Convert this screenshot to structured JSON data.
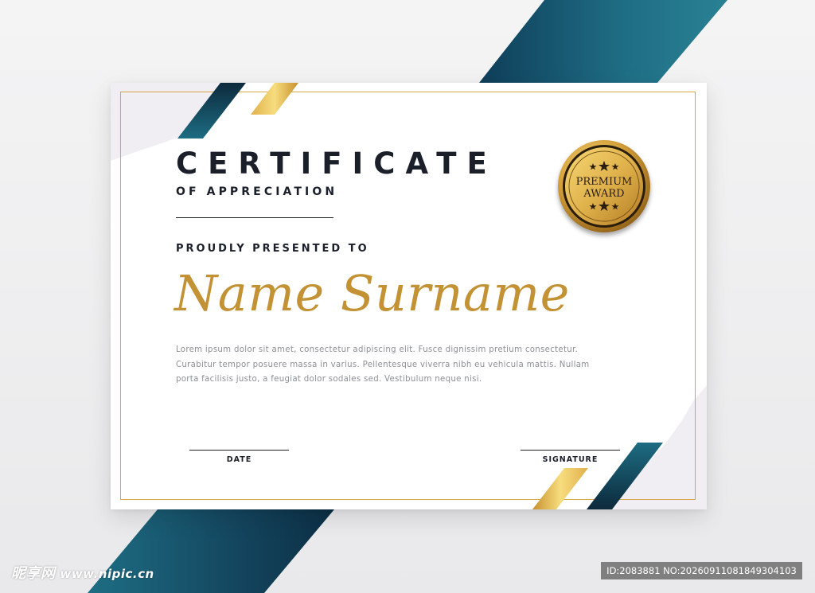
{
  "certificate": {
    "title": "CERTIFICATE",
    "subtitle": "OF APPRECIATION",
    "presented_label": "PROUDLY PRESENTED TO",
    "recipient_name": "Name Surname",
    "body_lines": [
      "Lorem ipsum dolor sit amet, consectetur adipiscing elit. Fusce dignissim pretium consectetur.",
      "Curabitur tempor posuere massa in varius. Pellentesque viverra nibh eu vehicula mattis. Nullam",
      "porta facilisis justo, a feugiat dolor sodales sed. Vestibulum neque nisi."
    ],
    "date_label": "DATE",
    "signature_label": "SIGNATURE",
    "seal": {
      "line1": "PREMIUM",
      "line2": "AWARD",
      "star_icon": "star-icon"
    }
  },
  "watermark": {
    "site_name": "昵享网",
    "site_url": "www.nipic.cn",
    "id_text": "ID:2083881 NO:20260911081849304103"
  },
  "colors": {
    "teal": "#1d6c82",
    "navy": "#0d2a3c",
    "gold": "#c39234",
    "text_dark": "#1a1f2a",
    "text_muted": "#8c8f96"
  }
}
